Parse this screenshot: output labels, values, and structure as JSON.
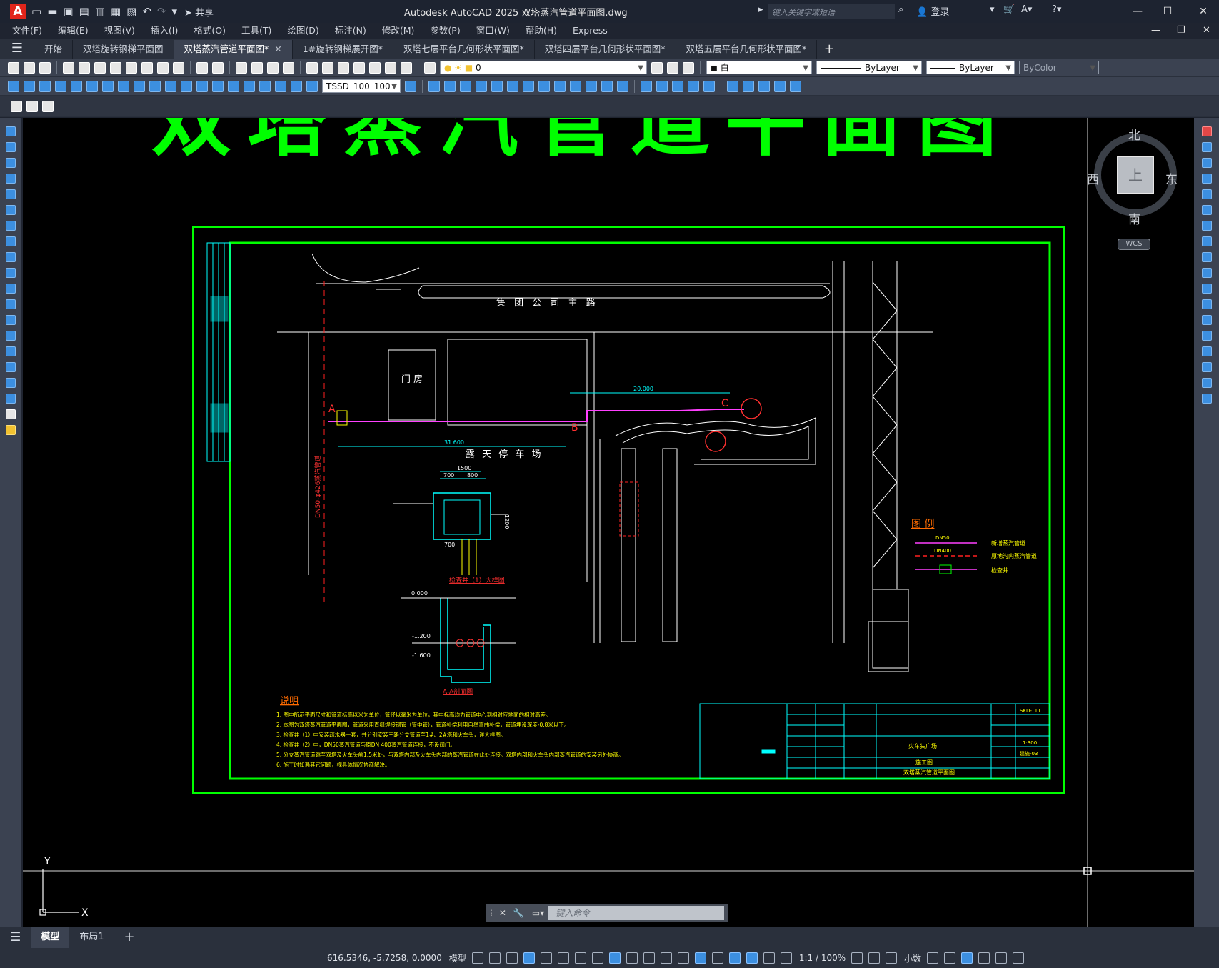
{
  "titlebar": {
    "app_logo": "A",
    "share_label": "共享",
    "title": "Autodesk AutoCAD 2025    双塔蒸汽管道平面图.dwg",
    "search_placeholder": "键入关键字或短语",
    "login_label": "登录"
  },
  "menu": [
    "文件(F)",
    "编辑(E)",
    "视图(V)",
    "插入(I)",
    "格式(O)",
    "工具(T)",
    "绘图(D)",
    "标注(N)",
    "修改(M)",
    "参数(P)",
    "窗口(W)",
    "帮助(H)",
    "Express"
  ],
  "tabs": [
    {
      "label": "开始",
      "active": false
    },
    {
      "label": "双塔旋转钢梯平面图",
      "active": false
    },
    {
      "label": "双塔蒸汽管道平面图*",
      "active": true
    },
    {
      "label": "1#旋转钢梯展开图*",
      "active": false
    },
    {
      "label": "双塔七层平台几何形状平面图*",
      "active": false
    },
    {
      "label": "双塔四层平台几何形状平面图*",
      "active": false
    },
    {
      "label": "双塔五层平台几何形状平面图*",
      "active": false
    }
  ],
  "properties": {
    "layer": "0",
    "color": "白",
    "linetype": "ByLayer",
    "lineweight": "ByLayer",
    "plotstyle": "ByColor",
    "dimstyle": "TSSD_100_100"
  },
  "drawing": {
    "big_title": "双塔蒸汽管道平面图",
    "road_label": "集 团 公 司 主 路",
    "guard_label": "门 房",
    "parking_label": "露 天 停 车 场",
    "dim_31600": "31.600",
    "dim_20000": "20.000",
    "dim_1500": "1500",
    "dim_700a": "700",
    "dim_800": "800",
    "dim_1200": "1200",
    "dim_700b": "700",
    "point_a": "A",
    "point_b": "B",
    "point_c": "C",
    "vertical_pipe_label": "DN50-φ426蒸汽管道",
    "section1_label": "检查井（1）大样图",
    "section2_label": "A-A剖面图",
    "level_0": "0.000",
    "level_1": "-1.200",
    "level_2": "-1.600",
    "legend": {
      "title": "图 例",
      "items": [
        {
          "code": "DN50",
          "desc": "新增蒸汽管道"
        },
        {
          "code": "DN400",
          "desc": "原地沟内蒸汽管道"
        },
        {
          "code": "",
          "desc": "检查井"
        }
      ]
    },
    "notes_title": "说明",
    "notes": [
      "1. 图中所示平面尺寸和管道标高以米为单位，管径以毫米为单位，其中标高均为管道中心到相对应地面的相对高差。",
      "2. 本图为双塔蒸汽管道平面图，管道采用直缝焊接钢管（管中管），管道补偿利用自然弯曲补偿，管道埋设深度-0.8米以下。",
      "3. 检查井（1）中安装疏水器一套，并分别安装三路分支管道至1#、2#塔和火车头，详大样图。",
      "4. 检查井（2）中，DN50蒸汽管道与原DN 400蒸汽管道连接，不设阀门。",
      "5. 分支蒸汽管道跳至双塔及火车头前1.5米处，与双塔内部及火车头内部的蒸汽管道在此处连接。双塔内部和火车头内部蒸汽管道的安装另外协商。",
      "6. 施工时如遇其它问题，视具体情况协商解决。"
    ],
    "titleblock": {
      "project": "火车头广场",
      "drawing_name": "双塔蒸汽管道平面图",
      "stage": "施工图",
      "scale": "1:300",
      "number": "SKD-T11",
      "sheet": "建施-03"
    }
  },
  "viewcube": {
    "north": "北",
    "south": "南",
    "east": "东",
    "west": "西",
    "top": "上",
    "wcs": "WCS"
  },
  "ucs": {
    "x": "X",
    "y": "Y"
  },
  "command": {
    "placeholder": "键入命令"
  },
  "layout_tabs": [
    {
      "label": "模型",
      "active": true
    },
    {
      "label": "布局1",
      "active": false
    }
  ],
  "status": {
    "coords": "616.5346, -5.7258, 0.0000",
    "space": "模型",
    "annoscale": "1:1 / 100%",
    "units": "小数"
  }
}
